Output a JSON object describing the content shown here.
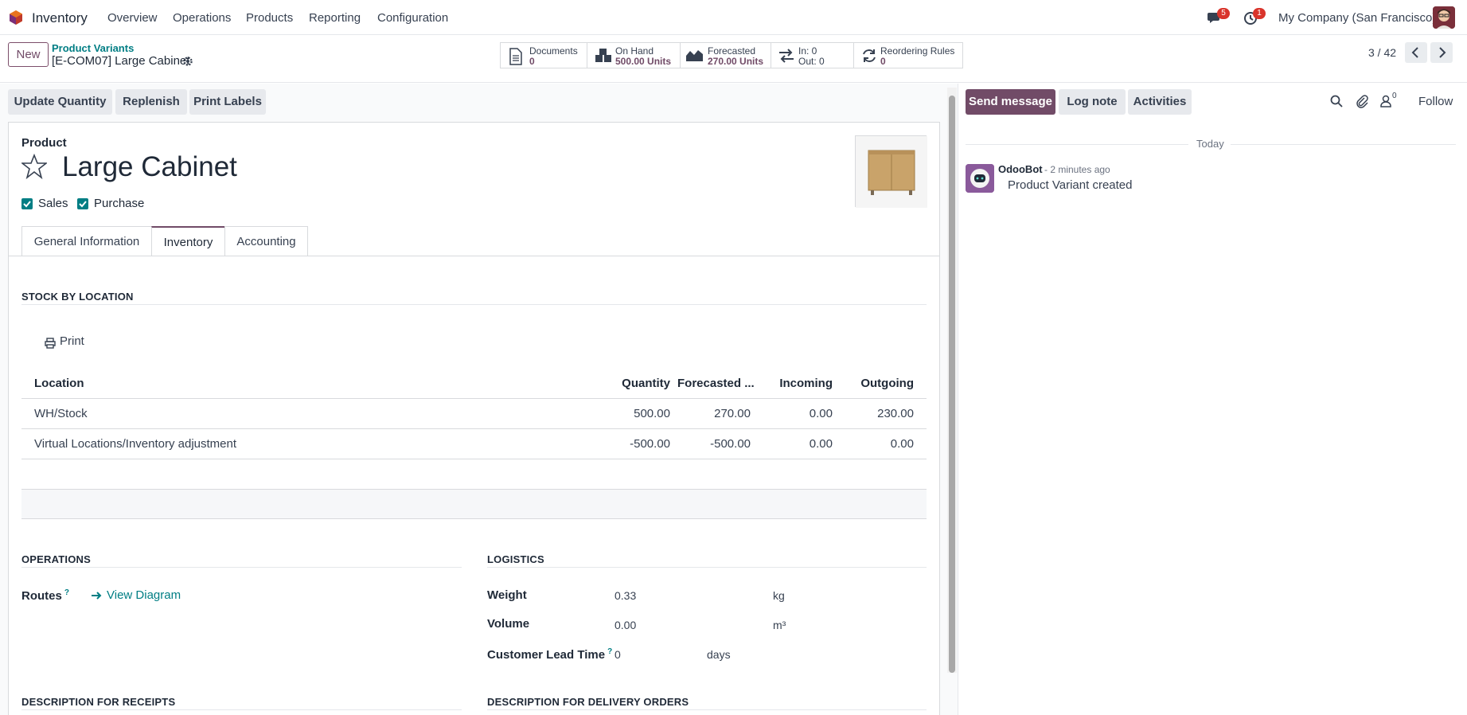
{
  "navbar": {
    "app_name": "Inventory",
    "menu": [
      "Overview",
      "Operations",
      "Products",
      "Reporting",
      "Configuration"
    ],
    "messages_count": "5",
    "activities_count": "1",
    "company": "My Company (San Francisco)"
  },
  "control_panel": {
    "new_label": "New",
    "breadcrumb_parent": "Product Variants",
    "breadcrumb_current": "[E-COM07] Large Cabinet",
    "smart_buttons": [
      {
        "label": "Documents",
        "value": "0"
      },
      {
        "label": "On Hand",
        "value": "500.00 Units"
      },
      {
        "label": "Forecasted",
        "value": "270.00 Units"
      },
      {
        "label": "In: 0",
        "value": "Out: 0"
      },
      {
        "label": "Reordering Rules",
        "value": "0"
      }
    ],
    "pager": "3 / 42"
  },
  "actions": {
    "update_quantity": "Update Quantity",
    "replenish": "Replenish",
    "print_labels": "Print Labels"
  },
  "product": {
    "label": "Product",
    "name": "Large Cabinet",
    "sales_label": "Sales",
    "purchase_label": "Purchase"
  },
  "tabs": [
    "General Information",
    "Inventory",
    "Accounting"
  ],
  "stock": {
    "section_title": "STOCK BY LOCATION",
    "print_label": "Print",
    "headers": [
      "Location",
      "Quantity",
      "Forecasted ...",
      "Incoming",
      "Outgoing"
    ],
    "rows": [
      [
        "WH/Stock",
        "500.00",
        "270.00",
        "0.00",
        "230.00"
      ],
      [
        "Virtual Locations/Inventory adjustment",
        "-500.00",
        "-500.00",
        "0.00",
        "0.00"
      ]
    ]
  },
  "operations": {
    "section_title": "OPERATIONS",
    "routes_label": "Routes",
    "help": "?",
    "view_diagram": "View Diagram"
  },
  "logistics": {
    "section_title": "LOGISTICS",
    "weight_label": "Weight",
    "weight_value": "0.33",
    "weight_unit": "kg",
    "volume_label": "Volume",
    "volume_value": "0.00",
    "volume_unit": "m³",
    "lead_label": "Customer Lead Time",
    "lead_value": "0",
    "lead_unit": "days"
  },
  "descriptions": {
    "receipts": "DESCRIPTION FOR RECEIPTS",
    "delivery": "DESCRIPTION FOR DELIVERY ORDERS"
  },
  "chatter": {
    "send_message": "Send message",
    "log_note": "Log note",
    "activities": "Activities",
    "followers_count": "0",
    "follow": "Follow",
    "today": "Today",
    "author": "OdooBot",
    "time": "- 2 minutes ago",
    "message": "Product Variant created"
  },
  "colors": {
    "brand": "#714b67",
    "link": "#017e84",
    "badge": "#d9342b"
  }
}
